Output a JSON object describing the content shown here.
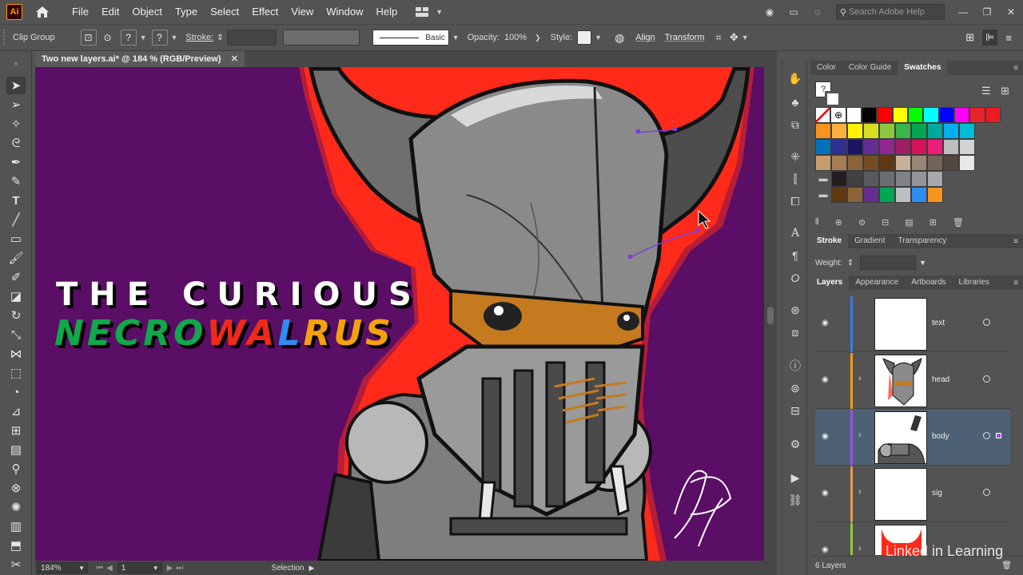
{
  "app": {
    "logo": "Ai"
  },
  "menu": {
    "items": [
      "File",
      "Edit",
      "Object",
      "Type",
      "Select",
      "Effect",
      "View",
      "Window",
      "Help"
    ]
  },
  "search": {
    "placeholder": "Search Adobe Help"
  },
  "control": {
    "selection_type": "Clip Group",
    "stroke_label": "Stroke:",
    "brush_label": "Basic",
    "opacity_label": "Opacity:",
    "opacity_value": "100%",
    "style_label": "Style:",
    "align_link": "Align",
    "transform_link": "Transform"
  },
  "document": {
    "tab_title": "Two new layers.ai* @ 184 % (RGB/Preview)"
  },
  "artwork": {
    "headline_line1": "THE CURIOUS",
    "headline_line2_parts": [
      {
        "text": "NECRO",
        "color": "#0fa84a"
      },
      {
        "text": "WA",
        "color": "#f02a1b"
      },
      {
        "text": "L",
        "color": "#2f8cf0"
      },
      {
        "text": "RUS",
        "color": "#f5a10c"
      }
    ]
  },
  "status": {
    "zoom": "184%",
    "artboard": "1",
    "tool": "Selection"
  },
  "color_panel": {
    "tabs": [
      "Color",
      "Color Guide",
      "Swatches"
    ],
    "active_tab": "Swatches"
  },
  "swatches": [
    [
      "#ffffff",
      "#000000",
      "#ff0000",
      "#ffff00",
      "#00ff00",
      "#00ffff",
      "#0000ff",
      "#ff00ff",
      "#e8232b",
      "#ed1c24"
    ],
    [
      "#f7941d",
      "#fbb040",
      "#fff200",
      "#d7df23",
      "#8dc63f",
      "#39b54a",
      "#00a651",
      "#00a79d",
      "#00aeef",
      "#00bcd4"
    ],
    [
      "#0072bc",
      "#2e3192",
      "#1b1464",
      "#662d91",
      "#92278f",
      "#9e1f63",
      "#d4145a",
      "#ed1e79",
      "#bcbec0",
      "#d1d3d4"
    ],
    [
      "#c69c6d",
      "#a67c52",
      "#8c6239",
      "#754c24",
      "#603913",
      "#c7b299",
      "#998675",
      "#736357",
      "#534741",
      "#e6e7e8"
    ],
    [
      "#231f20",
      "#414042",
      "#58595b",
      "#6d6e71",
      "#808285",
      "#939598",
      "#a7a9ac"
    ],
    [
      "#603913",
      "#8c6239",
      "#662d91",
      "#00a651",
      "#bcbec0",
      "#2f8cf0",
      "#f7941d"
    ]
  ],
  "stroke_panel": {
    "tabs": [
      "Stroke",
      "Gradient",
      "Transparency"
    ],
    "active_tab": "Stroke",
    "weight_label": "Weight:"
  },
  "layers_panel": {
    "tabs": [
      "Layers",
      "Appearance",
      "Artboards",
      "Libraries"
    ],
    "active_tab": "Layers",
    "layers": [
      {
        "name": "text",
        "color": "#3d7be3"
      },
      {
        "name": "head",
        "color": "#f59a1a"
      },
      {
        "name": "body",
        "color": "#9b4fe3"
      },
      {
        "name": "sig",
        "color": "#e39b4f"
      },
      {
        "name": "",
        "color": "#8dcc3a"
      }
    ],
    "count_label": "6 Layers"
  },
  "watermark": "Linked in Learning"
}
